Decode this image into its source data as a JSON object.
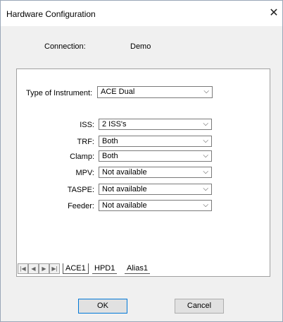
{
  "window": {
    "title": "Hardware Configuration",
    "close_glyph": "✕"
  },
  "connection": {
    "label": "Connection:",
    "value": "Demo"
  },
  "instrument": {
    "label": "Type of Instrument:",
    "value": "ACE Dual"
  },
  "fields": [
    {
      "label": "ISS:",
      "value": "2 ISS's"
    },
    {
      "label": "TRF:",
      "value": "Both"
    },
    {
      "label": "Clamp:",
      "value": "Both"
    },
    {
      "label": "MPV:",
      "value": "Not available"
    },
    {
      "label": "TASPE:",
      "value": "Not available"
    },
    {
      "label": "Feeder:",
      "value": "Not available"
    }
  ],
  "tabs": [
    "ACE1",
    "HPD1",
    "Alias1"
  ],
  "buttons": {
    "ok": "OK",
    "cancel": "Cancel"
  },
  "chevron": "⌵"
}
